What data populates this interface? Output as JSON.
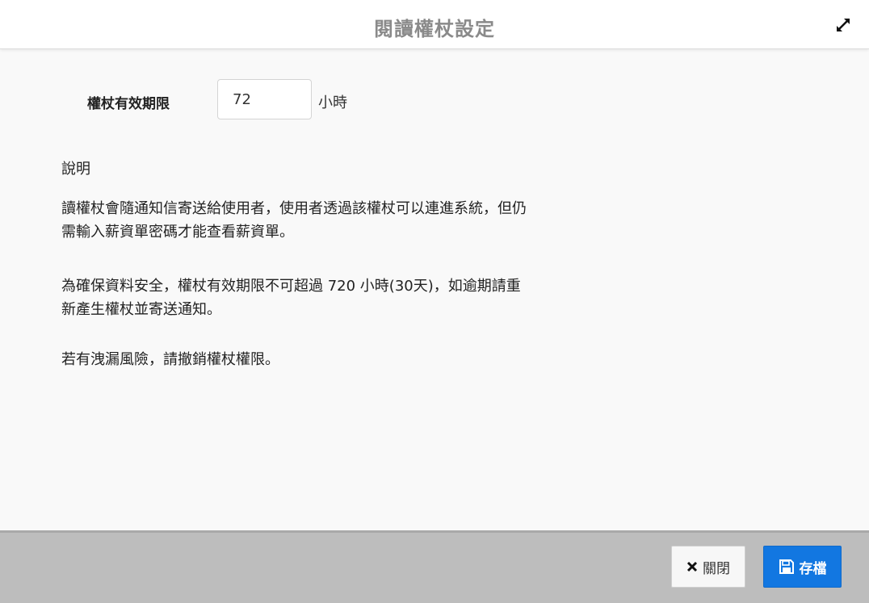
{
  "dialog": {
    "title": "閱讀權杖設定",
    "expand_icon": "expand-icon"
  },
  "form": {
    "label": "權杖有效期限",
    "value": "72",
    "unit": "小時"
  },
  "description": {
    "heading": "說明",
    "paragraphs": [
      "讀權杖會隨通知信寄送給使用者，使用者透過該權杖可以連進系統，但仍需輸入薪資單密碼才能查看薪資單。",
      "為確保資料安全，權杖有效期限不可超過 720 小時(30天)，如逾期請重新產生權杖並寄送通知。",
      "若有洩漏風險，請撤銷權杖權限。"
    ]
  },
  "footer": {
    "close_label": "關閉",
    "save_label": "存檔"
  },
  "colors": {
    "accent": "#1277e1",
    "footer_bg": "#bdbdbd",
    "title_text": "#8a8a8a"
  }
}
